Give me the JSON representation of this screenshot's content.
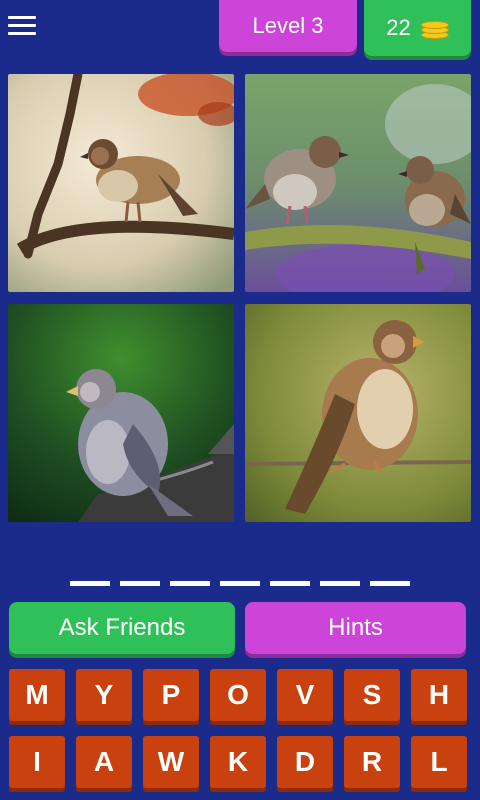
{
  "header": {
    "menu_icon": "hamburger-menu-icon",
    "level_label": "Level 3",
    "coins": "22",
    "coin_icon": "coin-stack-icon"
  },
  "colors": {
    "background": "#1a2b8c",
    "level_badge": "#cc44d8",
    "coin_badge": "#2fc05a",
    "key": "#c8410e"
  },
  "puzzle": {
    "answer_slots": 7,
    "images": [
      "sparrow on branch",
      "two sparrows on branch",
      "sparrow on stump",
      "sparrow on wire"
    ]
  },
  "buttons": {
    "ask_friends": "Ask Friends",
    "hints": "Hints"
  },
  "keyboard": {
    "row1": [
      "M",
      "Y",
      "P",
      "O",
      "V",
      "S",
      "H"
    ],
    "row2": [
      "I",
      "A",
      "W",
      "K",
      "D",
      "R",
      "L"
    ]
  }
}
